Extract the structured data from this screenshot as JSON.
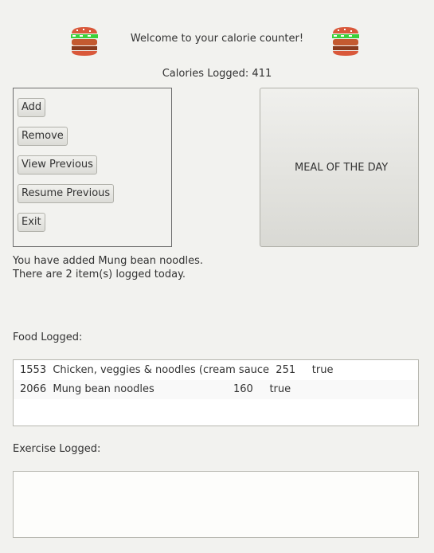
{
  "header": {
    "welcome_text": "Welcome to your calorie counter!",
    "calories_text": "Calories Logged: 411",
    "icons": [
      "burger-icon",
      "burger-icon"
    ]
  },
  "menu": {
    "add_label": "Add",
    "remove_label": "Remove",
    "view_previous_label": "View Previous",
    "resume_previous_label": "Resume Previous",
    "exit_label": "Exit"
  },
  "meal_of_the_day": {
    "label": "MEAL OF THE DAY"
  },
  "status": {
    "line1": "You have added Mung bean noodles.",
    "line2": "There are 2 item(s) logged today."
  },
  "food": {
    "heading": "Food Logged:",
    "items": [
      "1553  Chicken, veggies & noodles (cream sauce  251     true",
      "2066  Mung bean noodles                        160     true"
    ]
  },
  "exercise": {
    "heading": "Exercise Logged:",
    "items": []
  },
  "colors": {
    "background": "#f2f2ef",
    "text": "#333333",
    "burger_bun": "#d9583a",
    "burger_lettuce": "#3bd13b",
    "burger_patty": "#8a3b1e"
  }
}
